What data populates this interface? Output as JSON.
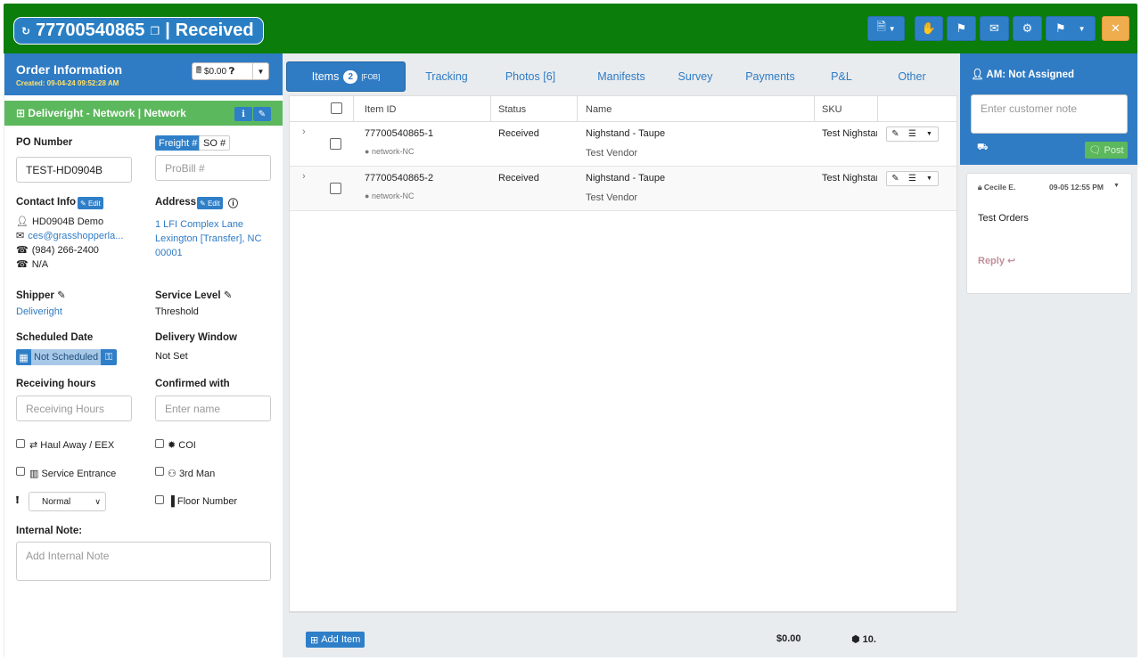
{
  "header": {
    "order_number": "77700540865",
    "status": "Received",
    "buttons": [
      "document-menu",
      "hand",
      "flag",
      "email",
      "settings",
      "flag-check-menu",
      "close"
    ]
  },
  "order_info": {
    "title": "Order Information",
    "created": "Created: 09-04-24 09:52:28 AM",
    "amount": "$0.00"
  },
  "network": {
    "label": "Deliveright - Network | Network"
  },
  "po": {
    "label": "PO Number",
    "value": "TEST-HD0904B",
    "freight_tab": "Freight #",
    "so_tab": "SO #",
    "probill_placeholder": "ProBill #"
  },
  "contact": {
    "label": "Contact Info",
    "edit": "Edit",
    "name": "HD0904B Demo",
    "email": "ces@grasshopperla...",
    "phone": "(984) 266-2400",
    "alt_phone": "N/A"
  },
  "address": {
    "label": "Address",
    "edit": "Edit",
    "line1": "1 LFI Complex Lane",
    "line2": "Lexington [Transfer], NC",
    "line3": "00001"
  },
  "shipper": {
    "label": "Shipper",
    "value": "Deliveright"
  },
  "service_level": {
    "label": "Service Level",
    "value": "Threshold"
  },
  "scheduled": {
    "label": "Scheduled Date",
    "value": "Not Scheduled"
  },
  "delivery_window": {
    "label": "Delivery Window",
    "value": "Not Set"
  },
  "receiving": {
    "label": "Receiving hours",
    "placeholder": "Receiving Hours"
  },
  "confirmed": {
    "label": "Confirmed with",
    "placeholder": "Enter name"
  },
  "checks": {
    "haul_away": "Haul Away / EEX",
    "coi": "COI",
    "service_entrance": "Service Entrance",
    "third_man": "3rd Man",
    "floor_number": "Floor Number",
    "priority": "Normal"
  },
  "internal_note": {
    "label": "Internal Note:",
    "placeholder": "Add Internal Note"
  },
  "tabs": [
    {
      "label": "Items",
      "count": "2",
      "sup": "[FOB]"
    },
    {
      "label": "Tracking"
    },
    {
      "label": "Photos [6]"
    },
    {
      "label": "Manifests"
    },
    {
      "label": "Survey"
    },
    {
      "label": "Payments"
    },
    {
      "label": "P&L"
    },
    {
      "label": "Other"
    }
  ],
  "items_table": {
    "headers": [
      "Item ID",
      "Status",
      "Name",
      "SKU"
    ],
    "rows": [
      {
        "item_id": "77700540865-1",
        "location": "network-NC",
        "status": "Received",
        "name": "Nighstand - Taupe",
        "vendor": "Test Vendor",
        "sku": "Test Nighstar"
      },
      {
        "item_id": "77700540865-2",
        "location": "network-NC",
        "status": "Received",
        "name": "Nighstand - Taupe",
        "vendor": "Test Vendor",
        "sku": "Test Nighstar"
      }
    ]
  },
  "footer": {
    "add_item": "Add Item",
    "total": "$0.00",
    "weight": "10."
  },
  "right_panel": {
    "am_label": "AM: Not Assigned",
    "note_placeholder": "Enter customer note",
    "post": "Post",
    "comment": {
      "author": "Cecile E.",
      "time": "09-05 12:55 PM",
      "text": "Test Orders",
      "reply": "Reply"
    }
  },
  "colors": {
    "header_green": "#0a7d0a",
    "primary_blue": "#2f7bc4",
    "success_green": "#5cb85c",
    "warning_orange": "#f0ad4e"
  }
}
